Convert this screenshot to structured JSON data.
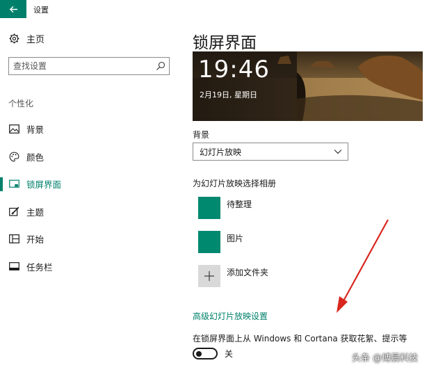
{
  "window": {
    "title": "设置"
  },
  "sidebar": {
    "home_label": "主页",
    "search_placeholder": "查找设置",
    "section_label": "个性化",
    "items": [
      {
        "label": "背景",
        "icon": "picture-icon"
      },
      {
        "label": "颜色",
        "icon": "palette-icon"
      },
      {
        "label": "锁屏界面",
        "icon": "lock-screen-icon",
        "active": true
      },
      {
        "label": "主题",
        "icon": "theme-icon"
      },
      {
        "label": "开始",
        "icon": "start-icon"
      },
      {
        "label": "任务栏",
        "icon": "taskbar-icon"
      }
    ]
  },
  "main": {
    "title": "锁屏界面",
    "preview": {
      "time": "19:46",
      "date": "2月19日, 星期日"
    },
    "background_label": "背景",
    "background_value": "幻灯片放映",
    "album_label": "为幻灯片放映选择相册",
    "albums": [
      {
        "name": "待整理"
      },
      {
        "name": "图片"
      }
    ],
    "add_folder_label": "添加文件夹",
    "advanced_link": "高级幻灯片放映设置",
    "tips_label": "在锁屏界面上从 Windows 和 Cortana 获取花絮、提示等",
    "toggle_state": "关",
    "toggle_on": false
  },
  "watermark": "头条 @博晨科技",
  "colors": {
    "accent": "#00806b",
    "tile": "#00896f",
    "arrow": "#d8261f"
  }
}
